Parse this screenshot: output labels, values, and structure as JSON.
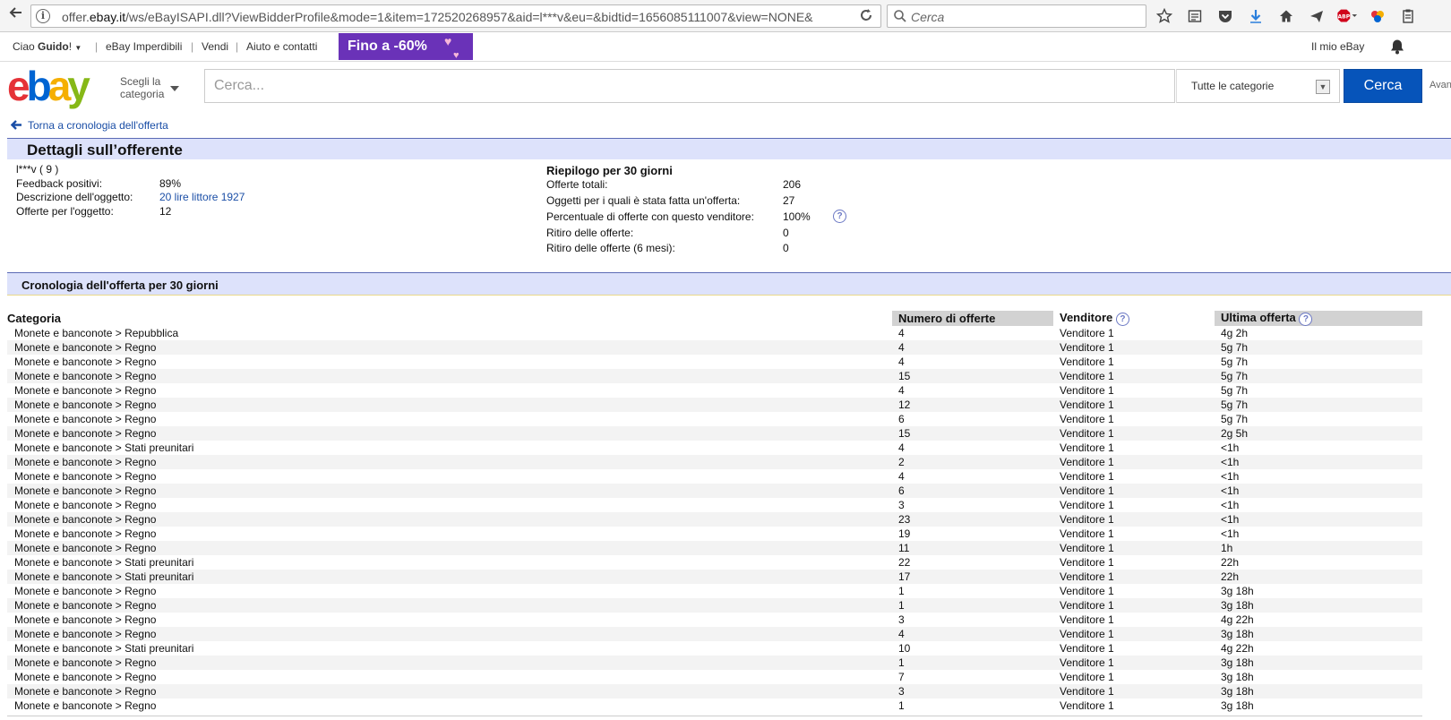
{
  "browser": {
    "url_prefix": "offer.",
    "url_domain": "ebay.it",
    "url_rest": "/ws/eBayISAPI.dll?ViewBidderProfile&mode=1&item=172520268957&aid=l***v&eu=&bidtid=1656085111007&view=NONE&",
    "search_placeholder": "Cerca",
    "icons": [
      "star-icon",
      "reader-icon",
      "pocket-icon",
      "download-icon",
      "home-icon",
      "send-icon",
      "adblock-icon",
      "extension-icon",
      "clipboard-icon"
    ]
  },
  "topnav": {
    "greeting_prefix": "Ciao ",
    "user": "Guido",
    "greeting_suffix": "!",
    "deals": "eBay Imperdibili",
    "sell": "Vendi",
    "help": "Aiuto e contatti",
    "promo": "Fino a -60%",
    "my_ebay": "Il mio eBay"
  },
  "header": {
    "choose_line1": "Scegli la",
    "choose_line2": "categoria",
    "search_placeholder": "Cerca...",
    "category_select": "Tutte le categorie",
    "search_button": "Cerca",
    "advanced": "Avanzata"
  },
  "back_link": "Torna a cronologia dell'offerta",
  "details": {
    "title": "Dettagli sull’offerente",
    "bidder": "l***v ( 9 )",
    "left": [
      {
        "label": "Feedback positivi:",
        "value": "89%"
      },
      {
        "label": "Descrizione dell'oggetto:",
        "value": "20 lire littore 1927"
      },
      {
        "label": "Offerte per l'oggetto:",
        "value": "12"
      }
    ],
    "summary_title": "Riepilogo per 30 giorni",
    "right": [
      {
        "label": "Offerte totali:",
        "value": "206"
      },
      {
        "label": "Oggetti per i quali è stata fatta un'offerta:",
        "value": "27"
      },
      {
        "label": "Percentuale di offerte con questo venditore:",
        "value": "100%"
      },
      {
        "label": "Ritiro delle offerte:",
        "value": "0"
      },
      {
        "label": "Ritiro delle offerte (6 mesi):",
        "value": "0"
      }
    ]
  },
  "history": {
    "title": "Cronologia dell'offerta per 30 giorni",
    "headers": [
      "Categoria",
      "Numero di offerte",
      "Venditore",
      "Ultima offerta"
    ],
    "rows": [
      [
        "Monete e banconote > Repubblica",
        "4",
        "Venditore 1",
        "4g 2h"
      ],
      [
        "Monete e banconote > Regno",
        "4",
        "Venditore 1",
        "5g 7h"
      ],
      [
        "Monete e banconote > Regno",
        "4",
        "Venditore 1",
        "5g 7h"
      ],
      [
        "Monete e banconote > Regno",
        "15",
        "Venditore 1",
        "5g 7h"
      ],
      [
        "Monete e banconote > Regno",
        "4",
        "Venditore 1",
        "5g 7h"
      ],
      [
        "Monete e banconote > Regno",
        "12",
        "Venditore 1",
        "5g 7h"
      ],
      [
        "Monete e banconote > Regno",
        "6",
        "Venditore 1",
        "5g 7h"
      ],
      [
        "Monete e banconote > Regno",
        "15",
        "Venditore 1",
        "2g 5h"
      ],
      [
        "Monete e banconote > Stati preunitari",
        "4",
        "Venditore 1",
        "<1h"
      ],
      [
        "Monete e banconote > Regno",
        "2",
        "Venditore 1",
        "<1h"
      ],
      [
        "Monete e banconote > Regno",
        "4",
        "Venditore 1",
        "<1h"
      ],
      [
        "Monete e banconote > Regno",
        "6",
        "Venditore 1",
        "<1h"
      ],
      [
        "Monete e banconote > Regno",
        "3",
        "Venditore 1",
        "<1h"
      ],
      [
        "Monete e banconote > Regno",
        "23",
        "Venditore 1",
        "<1h"
      ],
      [
        "Monete e banconote > Regno",
        "19",
        "Venditore 1",
        "<1h"
      ],
      [
        "Monete e banconote > Regno",
        "11",
        "Venditore 1",
        "1h"
      ],
      [
        "Monete e banconote > Stati preunitari",
        "22",
        "Venditore 1",
        "22h"
      ],
      [
        "Monete e banconote > Stati preunitari",
        "17",
        "Venditore 1",
        "22h"
      ],
      [
        "Monete e banconote > Regno",
        "1",
        "Venditore 1",
        "3g 18h"
      ],
      [
        "Monete e banconote > Regno",
        "1",
        "Venditore 1",
        "3g 18h"
      ],
      [
        "Monete e banconote > Regno",
        "3",
        "Venditore 1",
        "4g 22h"
      ],
      [
        "Monete e banconote > Regno",
        "4",
        "Venditore 1",
        "3g 18h"
      ],
      [
        "Monete e banconote > Stati preunitari",
        "10",
        "Venditore 1",
        "4g 22h"
      ],
      [
        "Monete e banconote > Regno",
        "1",
        "Venditore 1",
        "3g 18h"
      ],
      [
        "Monete e banconote > Regno",
        "7",
        "Venditore 1",
        "3g 18h"
      ],
      [
        "Monete e banconote > Regno",
        "3",
        "Venditore 1",
        "3g 18h"
      ],
      [
        "Monete e banconote > Regno",
        "1",
        "Venditore 1",
        "3g 18h"
      ]
    ]
  }
}
